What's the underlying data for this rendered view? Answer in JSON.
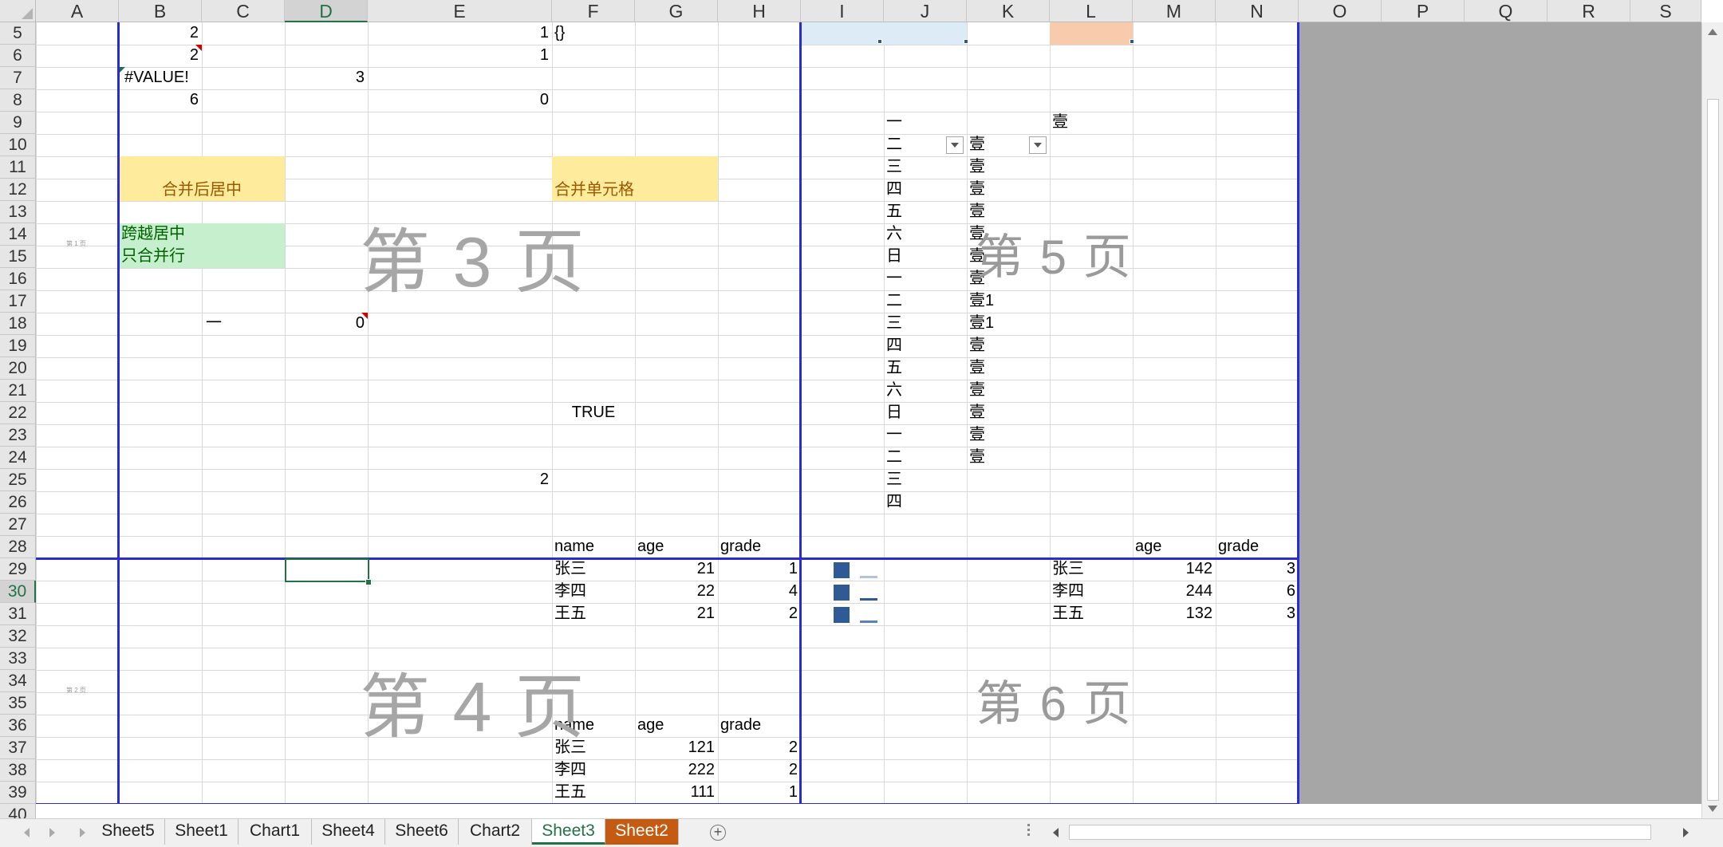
{
  "columns": [
    "A",
    "B",
    "C",
    "D",
    "E",
    "F",
    "G",
    "H",
    "I",
    "J",
    "K",
    "L",
    "M",
    "N",
    "O",
    "P",
    "Q",
    "R",
    "S"
  ],
  "selected_column": "D",
  "rows": [
    "5",
    "6",
    "7",
    "8",
    "9",
    "10",
    "11",
    "12",
    "13",
    "14",
    "15",
    "16",
    "17",
    "18",
    "19",
    "20",
    "21",
    "22",
    "23",
    "24",
    "25",
    "26",
    "27",
    "28",
    "29",
    "30",
    "31",
    "32",
    "33",
    "34",
    "35",
    "36",
    "37",
    "38",
    "39",
    "40"
  ],
  "selected_row": "30",
  "cells": {
    "B5": "2",
    "B6": "2",
    "B7": "#VALUE!",
    "B8": "6",
    "D7": "3",
    "C18": "一",
    "D18": "0",
    "E5": "1",
    "E6": "1",
    "E8": "0",
    "E25": "2",
    "F5": "{}",
    "F22": "TRUE",
    "merge_center": "合并后居中",
    "merge_cells": "合并单元格",
    "across_center_1": "跨越居中",
    "across_center_2": "只合并行",
    "L9": "壹"
  },
  "weekday_list": [
    "一",
    "二",
    "三",
    "四",
    "五",
    "六",
    "日",
    "一",
    "二",
    "三",
    "四",
    "五",
    "六",
    "日",
    "一",
    "二",
    "三",
    "四"
  ],
  "capital_list": [
    "壹",
    "壹",
    "壹",
    "壹",
    "壹",
    "壹",
    "壹",
    "壹1",
    "壹1",
    "壹",
    "壹",
    "壹",
    "壹",
    "壹",
    "壹"
  ],
  "table_top": {
    "headers": [
      "name",
      "age",
      "grade"
    ],
    "rows": [
      [
        "张三",
        "21",
        "1"
      ],
      [
        "李四",
        "22",
        "4"
      ],
      [
        "王五",
        "21",
        "2"
      ]
    ]
  },
  "table_right": {
    "headers": [
      "age",
      "grade"
    ],
    "rows": [
      [
        "张三",
        "142",
        "3"
      ],
      [
        "李四",
        "244",
        "6"
      ],
      [
        "王五",
        "132",
        "3"
      ]
    ]
  },
  "table_bottom": {
    "headers": [
      "name",
      "age",
      "grade"
    ],
    "rows": [
      [
        "张三",
        "121",
        "2"
      ],
      [
        "李四",
        "222",
        "2"
      ],
      [
        "王五",
        "111",
        "1"
      ]
    ]
  },
  "page_labels": [
    "第 3 页",
    "第 4 页",
    "第 5 页",
    "第 6 页"
  ],
  "small_page_labels": [
    "第 1 页",
    "第 2 页"
  ],
  "sheet_tabs": [
    "Sheet5",
    "Sheet1",
    "Chart1",
    "Sheet4",
    "Sheet6",
    "Chart2",
    "Sheet3",
    "Sheet2"
  ],
  "active_tab": "Sheet3",
  "colored_tab": "Sheet2",
  "colors": {
    "page_break": "#2b2bd4",
    "excel_green": "#217346",
    "yellow_fill": "#ffeb9c",
    "green_fill": "#c6efce",
    "sheet2_tab": "#c55a11",
    "legend_blue": "#2e5b96"
  }
}
